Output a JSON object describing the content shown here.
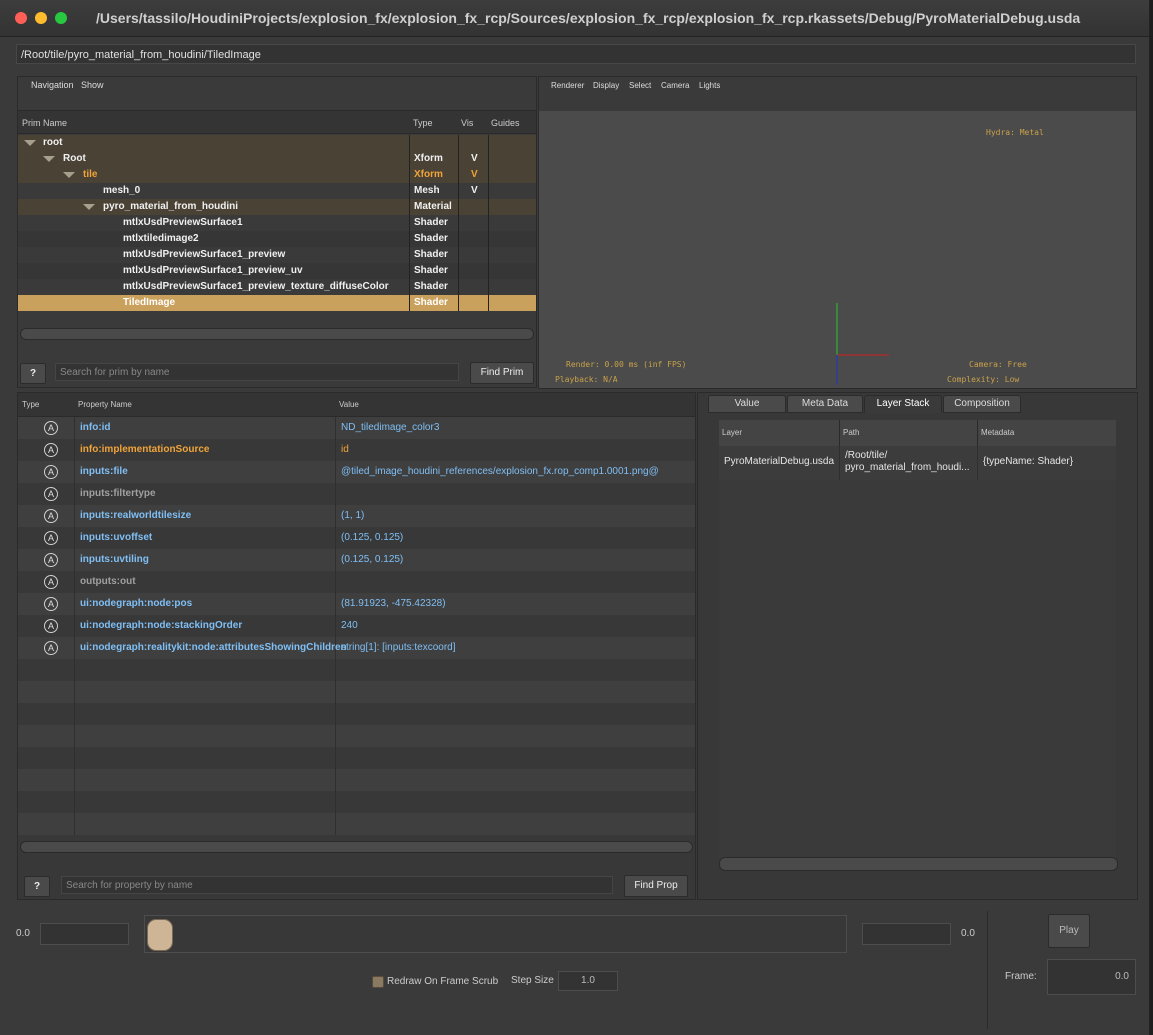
{
  "window": {
    "title": "/Users/tassilo/HoudiniProjects/explosion_fx/explosion_fx_rcp/Sources/explosion_fx_rcp/explosion_fx_rcp.rkassets/Debug/PyroMaterialDebug.usda"
  },
  "path_bar": "/Root/tile/pyro_material_from_houdini/TiledImage",
  "browser": {
    "menu": [
      "Navigation",
      "Show"
    ],
    "columns": [
      "Prim Name",
      "Type",
      "Vis",
      "Guides"
    ],
    "rows": [
      {
        "name": "root",
        "type": "",
        "vis": ""
      },
      {
        "name": "Root",
        "type": "Xform",
        "vis": "V"
      },
      {
        "name": "tile",
        "type": "Xform",
        "vis": "V"
      },
      {
        "name": "mesh_0",
        "type": "Mesh",
        "vis": "V"
      },
      {
        "name": "pyro_material_from_houdini",
        "type": "Material",
        "vis": ""
      },
      {
        "name": "mtlxUsdPreviewSurface1",
        "type": "Shader",
        "vis": ""
      },
      {
        "name": "mtlxtiledimage2",
        "type": "Shader",
        "vis": ""
      },
      {
        "name": "mtlxUsdPreviewSurface1_preview",
        "type": "Shader",
        "vis": ""
      },
      {
        "name": "mtlxUsdPreviewSurface1_preview_uv",
        "type": "Shader",
        "vis": ""
      },
      {
        "name": "mtlxUsdPreviewSurface1_preview_texture_diffuseColor",
        "type": "Shader",
        "vis": ""
      },
      {
        "name": "TiledImage",
        "type": "Shader",
        "vis": ""
      }
    ],
    "help_label": "?",
    "search_placeholder": "Search for prim by name",
    "find_label": "Find Prim"
  },
  "viewport": {
    "menu": [
      "Renderer",
      "Display",
      "Select",
      "Camera",
      "Lights"
    ],
    "hydra": "Hydra: Metal",
    "render": "Render: 0.00 ms (inf FPS)",
    "playback": "Playback: N/A",
    "camera": "Camera: Free",
    "complexity": "Complexity: Low"
  },
  "properties": {
    "columns": [
      "Type",
      "Property Name",
      "Value"
    ],
    "attr_icon": "A",
    "rows": [
      {
        "name": "info:id",
        "value": "ND_tiledimage_color3",
        "style": "blue"
      },
      {
        "name": "info:implementationSource",
        "value": "id",
        "style": "orange"
      },
      {
        "name": "inputs:file",
        "value": "@tiled_image_houdini_references/explosion_fx.rop_comp1.0001.png@",
        "style": "blue"
      },
      {
        "name": "inputs:filtertype",
        "value": "",
        "style": "gray"
      },
      {
        "name": "inputs:realworldtilesize",
        "value": "(1, 1)",
        "style": "blue"
      },
      {
        "name": "inputs:uvoffset",
        "value": "(0.125, 0.125)",
        "style": "blue"
      },
      {
        "name": "inputs:uvtiling",
        "value": "(0.125, 0.125)",
        "style": "blue"
      },
      {
        "name": "outputs:out",
        "value": "",
        "style": "gray"
      },
      {
        "name": "ui:nodegraph:node:pos",
        "value": "(81.91923, -475.42328)",
        "style": "blue"
      },
      {
        "name": "ui:nodegraph:node:stackingOrder",
        "value": "240",
        "style": "blue"
      },
      {
        "name": "ui:nodegraph:realitykit:node:attributesShowingChildren",
        "value": "string[1]: [inputs:texcoord]",
        "style": "blue"
      }
    ],
    "help_label": "?",
    "search_placeholder": "Search for property by name",
    "find_label": "Find Prop"
  },
  "layer_stack": {
    "tabs": [
      "Value",
      "Meta Data",
      "Layer Stack",
      "Composition"
    ],
    "active_tab": "Layer Stack",
    "columns": [
      "Layer",
      "Path",
      "Metadata"
    ],
    "row": {
      "layer": "PyroMaterialDebug.usda",
      "path_line1": "/Root/tile/",
      "path_line2": "pyro_material_from_houdi...",
      "metadata": "{typeName: Shader}"
    }
  },
  "timeline": {
    "start_value": "0.0",
    "end_value": "0.0",
    "play_label": "Play",
    "redraw_label": "Redraw On Frame Scrub",
    "step_label": "Step Size",
    "step_value": "1.0",
    "frame_label": "Frame:",
    "frame_value": "0.0"
  },
  "colors": {
    "blue": "#7fbff5",
    "orange": "#f0a43a",
    "gray": "#a0a0a0",
    "selected": "#c9a15c",
    "hud": "#c9a24a"
  }
}
